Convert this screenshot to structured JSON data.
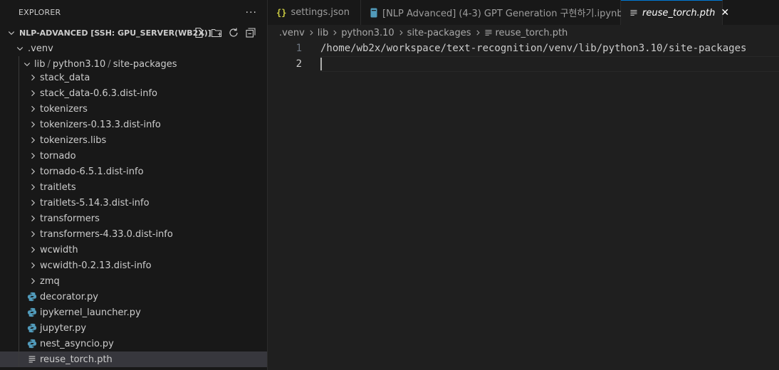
{
  "explorer": {
    "title": "EXPLORER",
    "more": "···",
    "workspace": "NLP-ADVANCED [SSH: GPU_SERVER(WB2X)]",
    "venv": ".venv",
    "compact_path": [
      "lib",
      "python3.10",
      "site-packages"
    ],
    "folders": [
      "stack_data",
      "stack_data-0.6.3.dist-info",
      "tokenizers",
      "tokenizers-0.13.3.dist-info",
      "tokenizers.libs",
      "tornado",
      "tornado-6.5.1.dist-info",
      "traitlets",
      "traitlets-5.14.3.dist-info",
      "transformers",
      "transformers-4.33.0.dist-info",
      "wcwidth",
      "wcwidth-0.2.13.dist-info",
      "zmq"
    ],
    "files": [
      {
        "name": "decorator.py",
        "icon": "python-icon"
      },
      {
        "name": "ipykernel_launcher.py",
        "icon": "python-icon"
      },
      {
        "name": "jupyter.py",
        "icon": "python-icon"
      },
      {
        "name": "nest_asyncio.py",
        "icon": "python-icon"
      },
      {
        "name": "reuse_torch.pth",
        "icon": "text-file-icon"
      }
    ]
  },
  "tabs": [
    {
      "label": "settings.json",
      "icon": "json-braces-icon"
    },
    {
      "label": "[NLP Advanced] (4-3) GPT Generation 구현하기.ipynb",
      "icon": "notebook-icon"
    },
    {
      "label": "reuse_torch.pth",
      "icon": "text-file-icon",
      "close": "✕"
    }
  ],
  "breadcrumbs": [
    ".venv",
    "lib",
    "python3.10",
    "site-packages",
    "reuse_torch.pth"
  ],
  "editor": {
    "lines": [
      {
        "number": "1",
        "text": "/home/wb2x/workspace/text-recognition/venv/lib/python3.10/site-packages"
      },
      {
        "number": "2",
        "text": ""
      }
    ]
  },
  "colors": {
    "accent": "#0078d4",
    "python_blue": "#519aba",
    "json_yellow": "#cbcb41"
  }
}
